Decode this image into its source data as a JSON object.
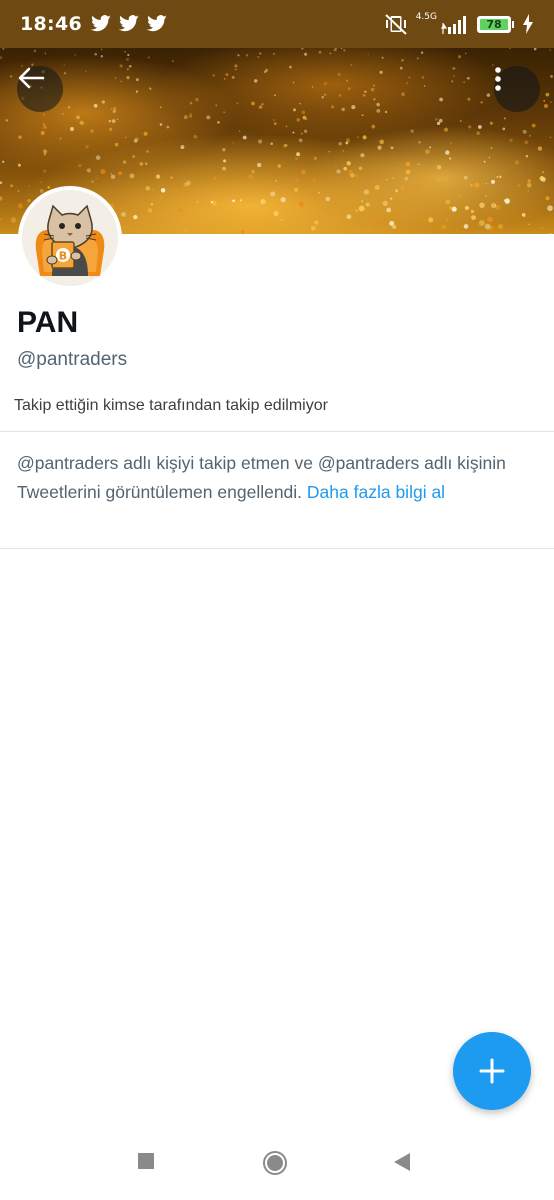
{
  "status_bar": {
    "time": "18:46",
    "network_label": "4.5G",
    "battery_level": "78"
  },
  "profile": {
    "display_name": "PAN",
    "handle": "@pantraders",
    "follow_info": "Takip ettiğin kimse tarafından takip edilmiyor"
  },
  "blocked_notice": {
    "message": "@pantraders adlı kişiyi takip etmen ve @pantraders adlı kişinin Tweetlerini görüntülemen engellendi.",
    "link_label": "Daha fazla bilgi al"
  },
  "colors": {
    "accent": "#1d9bf0",
    "status_bar": "#6e4a12",
    "secondary_text": "#536471"
  },
  "icons": {
    "back": "arrow-left-icon",
    "more": "more-vertical-icon",
    "fab": "plus-icon",
    "nav_recent": "square-icon",
    "nav_home": "circle-icon",
    "nav_back": "triangle-back-icon"
  }
}
